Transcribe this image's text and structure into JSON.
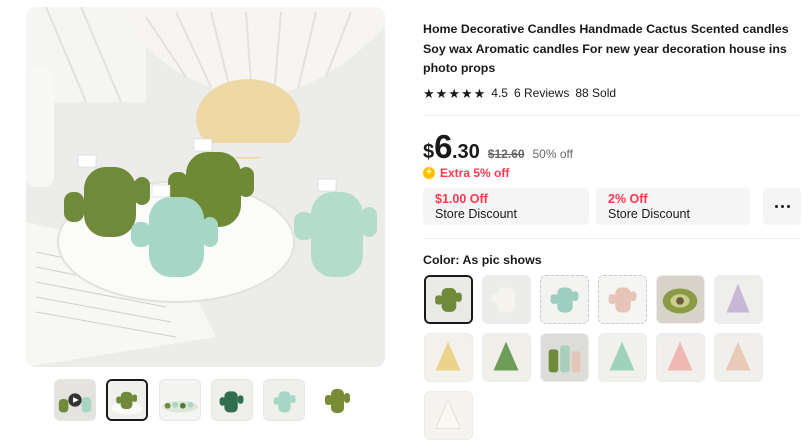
{
  "product": {
    "title": "Home Decorative Candles Handmade Cactus Scented candles Soy wax Aromatic candles For new year decoration house ins photo props",
    "rating": "4.5",
    "reviews": "6 Reviews",
    "sold": "88 Sold"
  },
  "price": {
    "currency": "$",
    "integer": "6",
    "decimal": ".30",
    "original": "$12.60",
    "discount": "50% off",
    "extra": "Extra 5% off"
  },
  "coupons": [
    {
      "amount": "$1.00 Off",
      "label": "Store Discount"
    },
    {
      "amount": "2% Off",
      "label": "Store Discount"
    }
  ],
  "color": {
    "label": "Color: As pic shows"
  },
  "gallery": {
    "thumbnails": [
      "video-thumb",
      "green-cactus-thumb",
      "tray-thumb",
      "dark-cactus-thumb",
      "mint-cactus-thumb",
      "olive-cactus-thumb"
    ],
    "active_index": 1
  },
  "swatch_colors": [
    "#6f8a3a",
    "#f1eee6",
    "#9ccfc0",
    "#e7c4b8",
    "#8b9a45",
    "#c9b7d6",
    "#ecd38a",
    "#6e9d5a",
    "#a9ceb9",
    "#9fd3b9",
    "#eeb8b0",
    "#e9c9b8",
    "#f1efe6"
  ],
  "icons": {
    "star": "star-icon",
    "coin": "coin-icon",
    "more": "more-dots-icon",
    "play": "play-icon"
  }
}
